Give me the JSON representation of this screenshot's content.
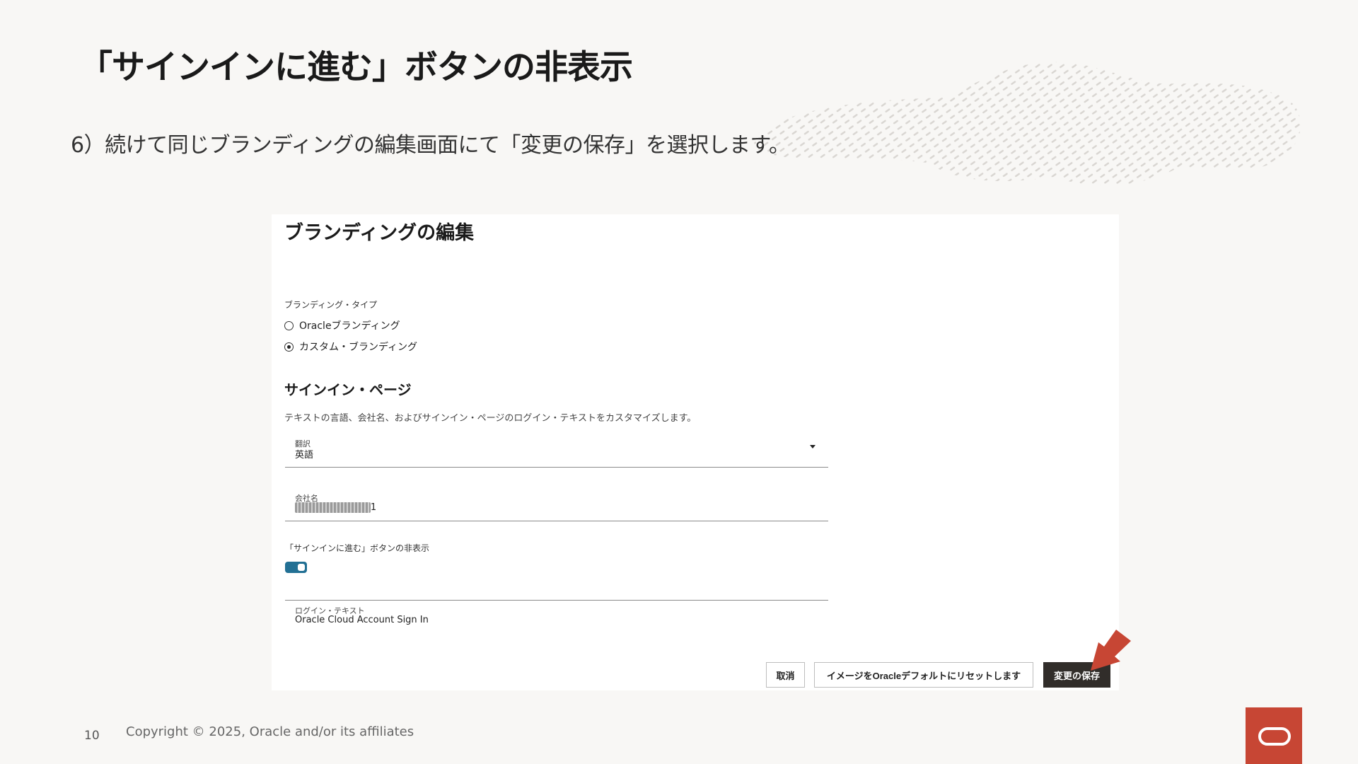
{
  "slide": {
    "title": "「サインインに進む」ボタンの非表示",
    "step_text": "6）続けて同じブランディングの編集画面にて「変更の保存」を選択します。",
    "page_number": "10",
    "copyright": "Copyright © 2025, Oracle and/or its affiliates"
  },
  "panel": {
    "title": "ブランディングの編集",
    "branding_type_label": "ブランディング・タイプ",
    "radio_options": [
      {
        "label": "Oracleブランディング",
        "selected": false
      },
      {
        "label": "カスタム・ブランディング",
        "selected": true
      }
    ],
    "section_heading": "サインイン・ページ",
    "section_description": "テキストの言語、会社名、およびサインイン・ページのログイン・テキストをカスタマイズします。",
    "translation_field": {
      "label": "翻訳",
      "value": "英語"
    },
    "company_field": {
      "label": "会社名",
      "value_prefix": "oraclejapanchild",
      "value_suffix": "1"
    },
    "toggle": {
      "label": "「サインインに進む」ボタンの非表示",
      "on": true
    },
    "login_text_field": {
      "label": "ログイン・テキスト",
      "value": "Oracle Cloud Account Sign In"
    },
    "buttons": {
      "cancel": "取消",
      "reset": "イメージをOracleデフォルトにリセットします",
      "save": "変更の保存"
    }
  },
  "colors": {
    "accent_red": "#c74634",
    "toggle_blue": "#227094",
    "primary_button": "#312d2a"
  },
  "icons": {
    "dropdown": "chevron-down-icon",
    "pointer": "red-arrow-icon",
    "logo": "oracle-logo"
  }
}
